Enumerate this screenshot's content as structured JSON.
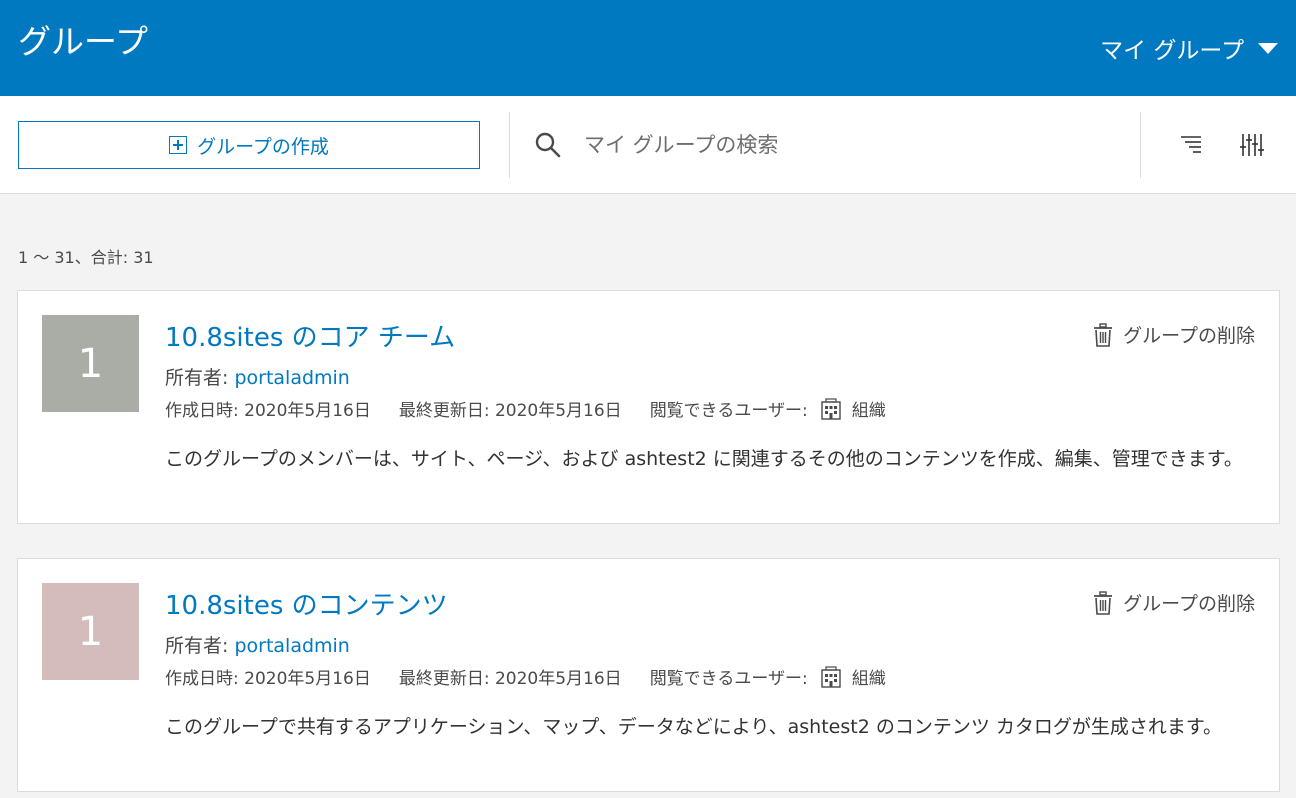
{
  "header": {
    "title": "グループ",
    "group_menu_label": "マイ グループ"
  },
  "toolbar": {
    "create_label": "グループの作成",
    "search_placeholder": "マイ グループの検索"
  },
  "results": {
    "count_text": "1 ～ 31、合計: 31"
  },
  "groups": [
    {
      "thumb_text": "1",
      "thumb_color": "#aaada5",
      "title": "10.8sites のコア チーム",
      "owner_label": "所有者:",
      "owner": "portaladmin",
      "created": "作成日時: 2020年5月16日",
      "modified": "最終更新日: 2020年5月16日",
      "access_label": "閲覧できるユーザー:",
      "access_value": "組織",
      "description": "このグループのメンバーは、サイト、ページ、および ashtest2 に関連するその他のコンテンツを作成、編集、管理できます。",
      "delete_label": "グループの削除"
    },
    {
      "thumb_text": "1",
      "thumb_color": "#d4bcbd",
      "title": "10.8sites のコンテンツ",
      "owner_label": "所有者:",
      "owner": "portaladmin",
      "created": "作成日時: 2020年5月16日",
      "modified": "最終更新日: 2020年5月16日",
      "access_label": "閲覧できるユーザー:",
      "access_value": "組織",
      "description": "このグループで共有するアプリケーション、マップ、データなどにより、ashtest2 のコンテンツ カタログが生成されます。",
      "delete_label": "グループの削除"
    }
  ]
}
